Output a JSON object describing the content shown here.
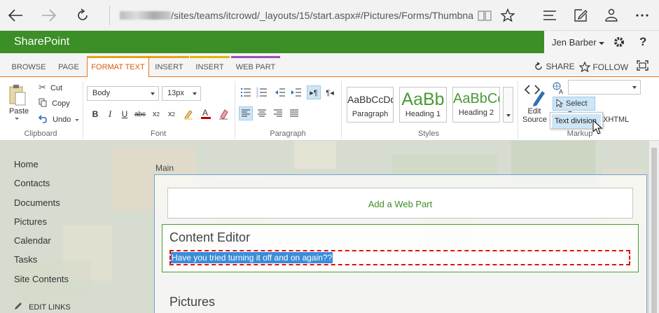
{
  "browser": {
    "url_visible": "/sites/teams/itcrowd/_layouts/15/start.aspx#/Pictures/Forms/Thumbna"
  },
  "suite": {
    "title": "SharePoint",
    "user": "Jen Barber"
  },
  "tabs": {
    "browse": "BROWSE",
    "page": "PAGE",
    "format_text": "FORMAT TEXT",
    "insert": "INSERT",
    "insert2": "INSERT",
    "web_part": "WEB PART"
  },
  "tab_actions": {
    "share": "SHARE",
    "follow": "FOLLOW"
  },
  "ribbon": {
    "clipboard": {
      "paste": "Paste",
      "cut": "Cut",
      "copy": "Copy",
      "undo": "Undo",
      "label": "Clipboard"
    },
    "font": {
      "style_value": "Body",
      "size_value": "13px",
      "label": "Font"
    },
    "paragraph": {
      "label": "Paragraph"
    },
    "styles": {
      "items": [
        {
          "preview": "AaBbCcDdE",
          "name": "Paragraph"
        },
        {
          "preview": "AaBb",
          "name": "Heading 1"
        },
        {
          "preview": "AaBbCc",
          "name": "Heading 2"
        }
      ],
      "label": "Styles"
    },
    "markup": {
      "edit_source_line1": "Edit",
      "edit_source_line2": "Source",
      "select": "Select",
      "xhtml_fragment": "XHTML",
      "label": "Markup",
      "popup_item": "Text division"
    }
  },
  "nav": {
    "items": [
      "Home",
      "Contacts",
      "Documents",
      "Pictures",
      "Calendar",
      "Tasks",
      "Site Contents"
    ],
    "edit_links": "EDIT LINKS"
  },
  "main": {
    "zone_label": "Main",
    "add_web_part": "Add a Web Part",
    "content_editor_title": "Content Editor",
    "selected_text": "Have you tried turning it off and on again??",
    "pictures_title": "Pictures"
  },
  "colors": {
    "suite_green": "#3c8e26",
    "active_tab": "#d95b0a",
    "selection": "#3b8cd8",
    "text_division_border": "#e01010"
  }
}
